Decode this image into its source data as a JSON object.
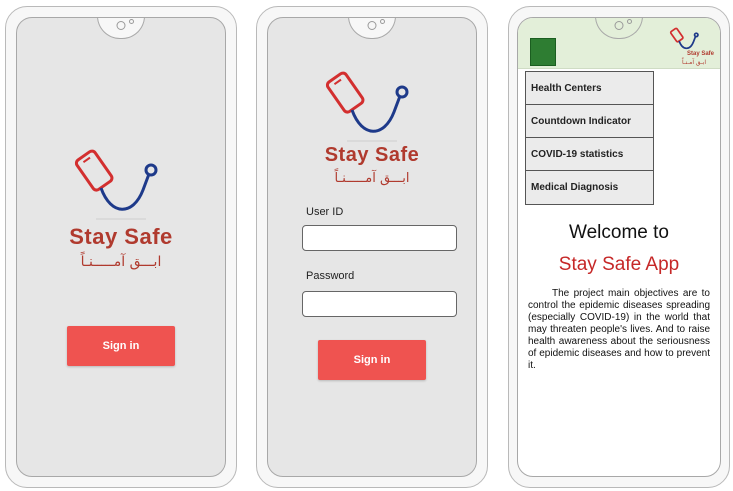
{
  "app": {
    "brand_name": "Stay Safe",
    "arabic_name": "ابـــق آمـــــنـاً",
    "brand_color": "#b03a2e",
    "button_color": "#ef5350",
    "icon": "phone-stethoscope-logo"
  },
  "splash_screen": {
    "sign_in_label": "Sign in"
  },
  "login_screen": {
    "user_id_label": "User ID",
    "password_label": "Password",
    "user_id_value": "",
    "password_value": "",
    "sign_in_label": "Sign in"
  },
  "home_screen": {
    "header_brand": "Stay Safe",
    "header_arabic": "ابـق آمـنـاً",
    "menu_items": [
      {
        "label": "Health Centers"
      },
      {
        "label": "Countdown Indicator"
      },
      {
        "label": "COVID-19 statistics"
      },
      {
        "label": "Medical Diagnosis"
      }
    ],
    "welcome": "Welcome to",
    "app_title": "Stay Safe App",
    "description": "The project main objectives are to control the epidemic diseases spreading (especially COVID-19) in the world that may threaten people's lives. And to raise health awareness about the seriousness of epidemic diseases and how to prevent it."
  }
}
